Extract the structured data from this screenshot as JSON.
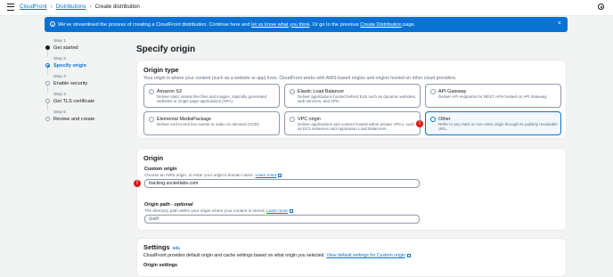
{
  "topbar": {
    "breadcrumb": [
      "CloudFront",
      "Distributions",
      "Create distribution"
    ]
  },
  "banner": {
    "text_before": "We've streamlined the process of creating a CloudFront distribution. Continue here and ",
    "feedback_link": "let us know what you think",
    "text_middle": ". Or go to the previous ",
    "previous_link": "Create Distribution",
    "text_after": " page."
  },
  "steps": [
    {
      "num": "Step 1",
      "label": "Get started",
      "state": "done"
    },
    {
      "num": "Step 2",
      "label": "Specify origin",
      "state": "active"
    },
    {
      "num": "Step 3",
      "label": "Enable security",
      "state": "pending"
    },
    {
      "num": "Step 4",
      "label": "Get TLS certificate",
      "state": "pending"
    },
    {
      "num": "Step 5",
      "label": "Review and create",
      "state": "pending"
    }
  ],
  "page_title": "Specify origin",
  "origin_type": {
    "heading": "Origin type",
    "description": "Your origin is where your content (such as a website or app) lives. CloudFront works with AWS-based origins and origins hosted on other cloud providers.",
    "options": [
      {
        "title": "Amazon S3",
        "desc": "Deliver static assets like files and images, statically generated websites or single page applications (SPA).",
        "selected": false
      },
      {
        "title": "Elastic Load Balancer",
        "desc": "Deliver applications hosted behind ELB such as dynamic websites, web services, and APIs.",
        "selected": false
      },
      {
        "title": "API Gateway",
        "desc": "Deliver API endpoints for REST APIs hosted on API Gateway.",
        "selected": false
      },
      {
        "title": "Elemental MediaPackage",
        "desc": "Deliver end-to-end live events or video on demand (VOD).",
        "selected": false
      },
      {
        "title": "VPC origin",
        "desc": "Deliver applications and content hosted within private VPCs, such as EC2 instances and Application Load Balancers.",
        "selected": false
      },
      {
        "title": "Other",
        "desc": "Refer to any AWS or non-AWS origin through its publicly resolvable URL.",
        "selected": true
      }
    ]
  },
  "origin": {
    "heading": "Origin",
    "custom_origin_label": "Custom origin",
    "custom_origin_desc": "Choose an AWS origin, or enter your origin's domain name.",
    "learn_more": "Learn more",
    "custom_origin_value": "tracking.socketlabs.com",
    "path_label": "Origin path",
    "path_optional": " - optional",
    "path_desc": "The directory path within your origin where your content is stored.",
    "path_placeholder": "/path"
  },
  "settings": {
    "heading": "Settings",
    "info": "Info",
    "description": "CloudFront provides default origin and cache settings based on what origin you selected.",
    "link": "View default settings for Custom origin",
    "subheading": "Origin settings"
  },
  "colors": {
    "accent": "#0972d3",
    "error": "#d91515",
    "background": "#f2f3f3"
  }
}
